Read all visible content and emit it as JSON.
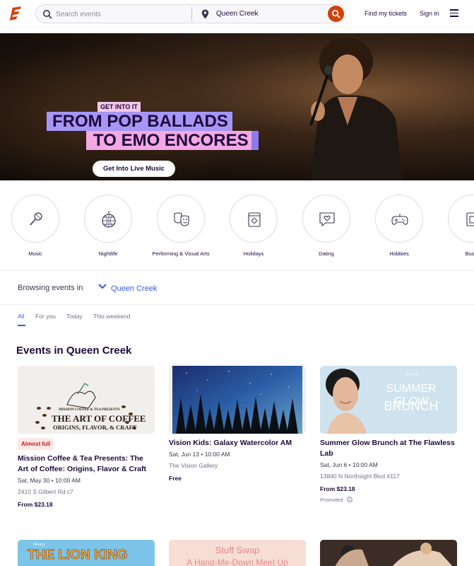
{
  "header": {
    "search_placeholder": "Search events",
    "location": "Queen Creek",
    "find_tickets": "Find my tickets",
    "sign_in": "Sign in",
    "brand_color": "#d1410c"
  },
  "hero": {
    "tagline": "GET INTO IT",
    "headline_1": "FROM POP BALLADS",
    "headline_2": "TO EMO ENCORES",
    "cta": "Get Into Live Music"
  },
  "categories": [
    {
      "label": "Music",
      "icon": "microphone-icon"
    },
    {
      "label": "Nightlife",
      "icon": "disco-ball-icon"
    },
    {
      "label": "Performing & Visual Arts",
      "icon": "theater-masks-icon"
    },
    {
      "label": "Holidays",
      "icon": "calendar-sun-icon"
    },
    {
      "label": "Dating",
      "icon": "chat-heart-icon"
    },
    {
      "label": "Hobbies",
      "icon": "gamepad-icon"
    },
    {
      "label": "Busin",
      "icon": "business-icon"
    }
  ],
  "browse": {
    "label": "Browsing events in",
    "location": "Queen Creek"
  },
  "tabs": [
    {
      "label": "All",
      "active": true
    },
    {
      "label": "For you",
      "active": false
    },
    {
      "label": "Today",
      "active": false
    },
    {
      "label": "This weekend",
      "active": false
    }
  ],
  "section_title": "Events in Queen Creek",
  "events": [
    {
      "badge": "Almost full",
      "title": "Mission Coffee & Tea Presents: The Art of Coffee: Origins, Flavor & Craft",
      "date": "Sat, May 30 • 10:00 AM",
      "venue": "2410 S Gilbert Rd c7",
      "price": "From $23.18",
      "thumb_text_1": "THE ART OF COFFEE",
      "thumb_text_2": "ORIGINS, FLAVOR, & CRAFT",
      "thumb_brand": "MISSION COFFEE & TEA PRESENTS"
    },
    {
      "title": "Vision Kids: Galaxy Watercolor AM",
      "date": "Sat, Jun 13 • 10:00 AM",
      "venue": "The Vision Gallery",
      "price": "Free"
    },
    {
      "title": "Summer Glow Brunch at The Flawless Lab",
      "date": "Sat, Jun 6 • 10:00 AM",
      "venue": "13840 N Northsight Blvd #117",
      "price": "From $23.18",
      "promoted": "Promoted",
      "thumb_text_1": "SUMMER GLOW",
      "thumb_text_2": "BRUNCH",
      "thumb_small": "JOIN US"
    }
  ],
  "more_events": [
    {
      "thumb_brand": "Disney",
      "thumb_text": "THE LION KING"
    },
    {
      "thumb_text_1": "Stuff Swap",
      "thumb_text_2": "A Hand-Me-Down Meet Up"
    },
    {}
  ]
}
